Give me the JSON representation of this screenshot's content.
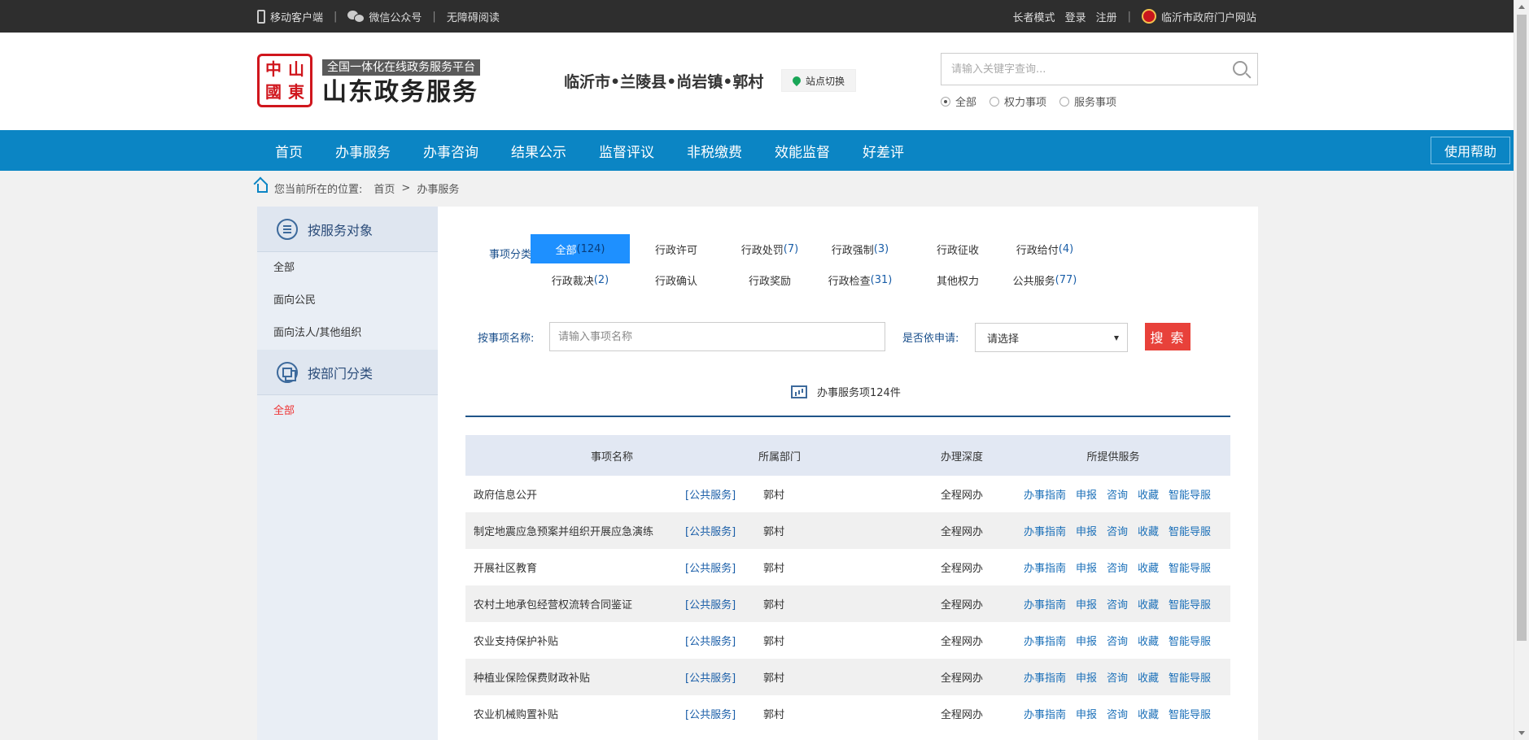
{
  "topbar": {
    "left": [
      "移动客户端",
      "微信公众号",
      "无障碍阅读"
    ],
    "right": [
      "长者模式",
      "登录",
      "注册"
    ],
    "portal": "临沂市政府门户网站",
    "divider": "|"
  },
  "header": {
    "logo_seal": [
      "中",
      "國",
      "山",
      "東"
    ],
    "logo_tag": "全国一体化在线政务服务平台",
    "logo_main": "山东政务服务",
    "location": "临沂市•兰陵县•尚岩镇•郭村",
    "switch_label": "站点切换",
    "search_placeholder": "请输入关键字查询...",
    "scope": [
      "全部",
      "权力事项",
      "服务事项"
    ]
  },
  "nav": {
    "items": [
      "首页",
      "办事服务",
      "办事咨询",
      "结果公示",
      "监督评议",
      "非税缴费",
      "效能监督",
      "好差评"
    ],
    "help": "使用帮助"
  },
  "breadcrumb": {
    "prefix": "您当前所在的位置:",
    "home": "首页",
    "sep": ">",
    "current": "办事服务"
  },
  "sidebar": {
    "by_target": "按服务对象",
    "targets": [
      "全部",
      "面向公民",
      "面向法人/其他组织"
    ],
    "by_dept": "按部门分类",
    "dept_all": "全部"
  },
  "filters": {
    "category_label": "事项分类:",
    "categories": [
      {
        "name": "全部",
        "count": "(124)"
      },
      {
        "name": "行政许可",
        "count": ""
      },
      {
        "name": "行政处罚",
        "count": "(7)"
      },
      {
        "name": "行政强制",
        "count": "(3)"
      },
      {
        "name": "行政征收",
        "count": ""
      },
      {
        "name": "行政给付",
        "count": "(4)"
      },
      {
        "name": "行政裁决",
        "count": "(2)"
      },
      {
        "name": "行政确认",
        "count": ""
      },
      {
        "name": "行政奖励",
        "count": ""
      },
      {
        "name": "行政检查",
        "count": "(31)"
      },
      {
        "name": "其他权力",
        "count": ""
      },
      {
        "name": "公共服务",
        "count": "(77)"
      }
    ],
    "name_label": "按事项名称:",
    "name_placeholder": "请输入事项名称",
    "apply_label": "是否依申请:",
    "apply_value": "请选择",
    "search_btn": "搜 索"
  },
  "summary": "办事服务项124件",
  "table": {
    "headers": [
      "事项名称",
      "所属部门",
      "办理深度",
      "所提供服务"
    ],
    "rows": [
      {
        "name": "政府信息公开",
        "type": "[公共服务]",
        "dept": "郭村",
        "depth": "全程网办"
      },
      {
        "name": "制定地震应急预案并组织开展应急演练",
        "type": "[公共服务]",
        "dept": "郭村",
        "depth": "全程网办"
      },
      {
        "name": "开展社区教育",
        "type": "[公共服务]",
        "dept": "郭村",
        "depth": "全程网办"
      },
      {
        "name": "农村土地承包经营权流转合同鉴证",
        "type": "[公共服务]",
        "dept": "郭村",
        "depth": "全程网办"
      },
      {
        "name": "农业支持保护补贴",
        "type": "[公共服务]",
        "dept": "郭村",
        "depth": "全程网办"
      },
      {
        "name": "种植业保险保费财政补贴",
        "type": "[公共服务]",
        "dept": "郭村",
        "depth": "全程网办"
      },
      {
        "name": "农业机械购置补贴",
        "type": "[公共服务]",
        "dept": "郭村",
        "depth": "全程网办"
      }
    ],
    "actions": [
      "办事指南",
      "申报",
      "咨询",
      "收藏",
      "智能导服"
    ]
  }
}
